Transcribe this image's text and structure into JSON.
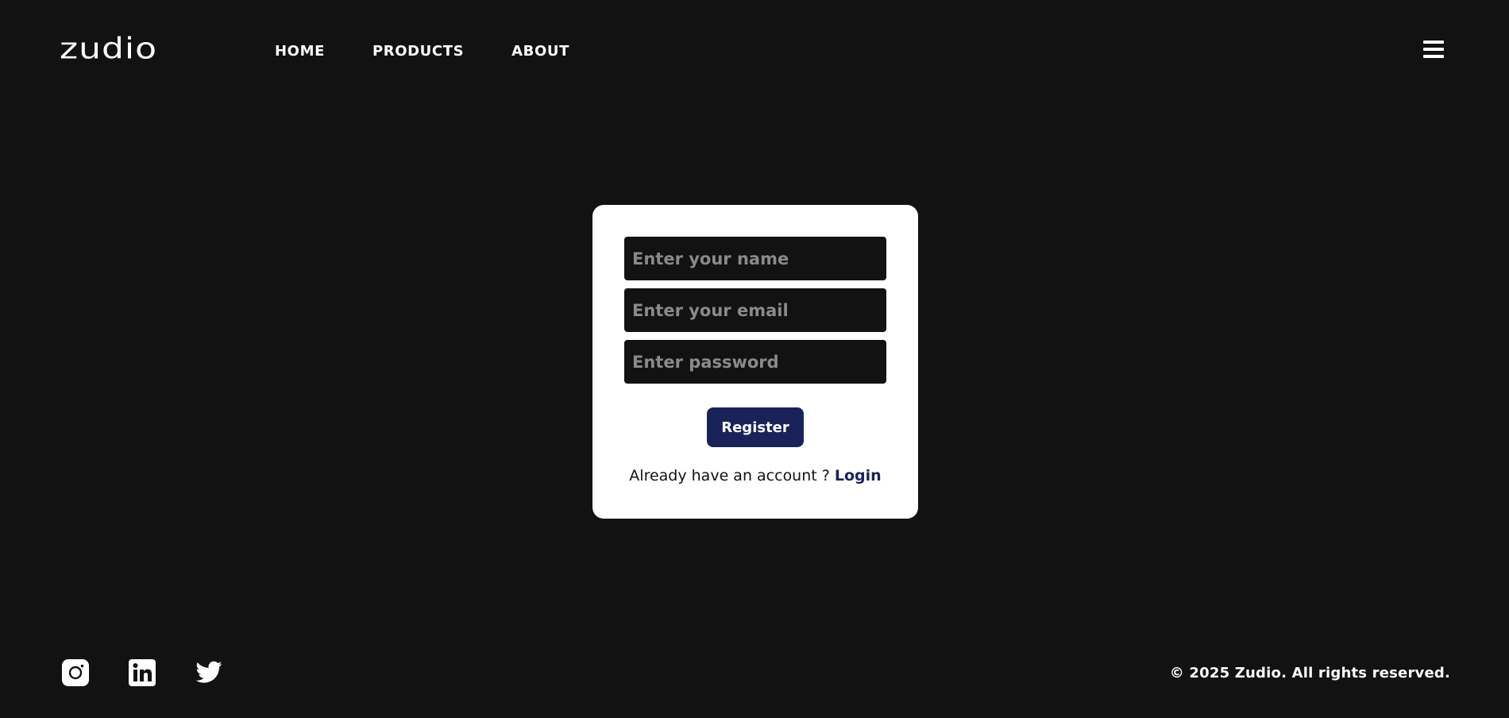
{
  "header": {
    "logo_text": "zudio",
    "nav": [
      {
        "label": "HOME"
      },
      {
        "label": "PRODUCTS"
      },
      {
        "label": "ABOUT"
      }
    ],
    "menu_icon": "hamburger-menu-icon"
  },
  "form": {
    "name_placeholder": "Enter your name",
    "name_value": "",
    "email_placeholder": "Enter your email",
    "email_value": "",
    "password_placeholder": "Enter password",
    "password_value": "",
    "register_label": "Register",
    "account_prompt": "Already have an account ? ",
    "login_label": "Login"
  },
  "footer": {
    "social": [
      {
        "icon": "instagram-icon"
      },
      {
        "icon": "linkedin-icon"
      },
      {
        "icon": "twitter-icon"
      }
    ],
    "copyright": "© 2025 Zudio. All rights reserved."
  },
  "colors": {
    "background": "#121212",
    "card": "#ffffff",
    "accent": "#19235a",
    "text_light": "#ffffff",
    "placeholder": "#8a8a8a"
  }
}
